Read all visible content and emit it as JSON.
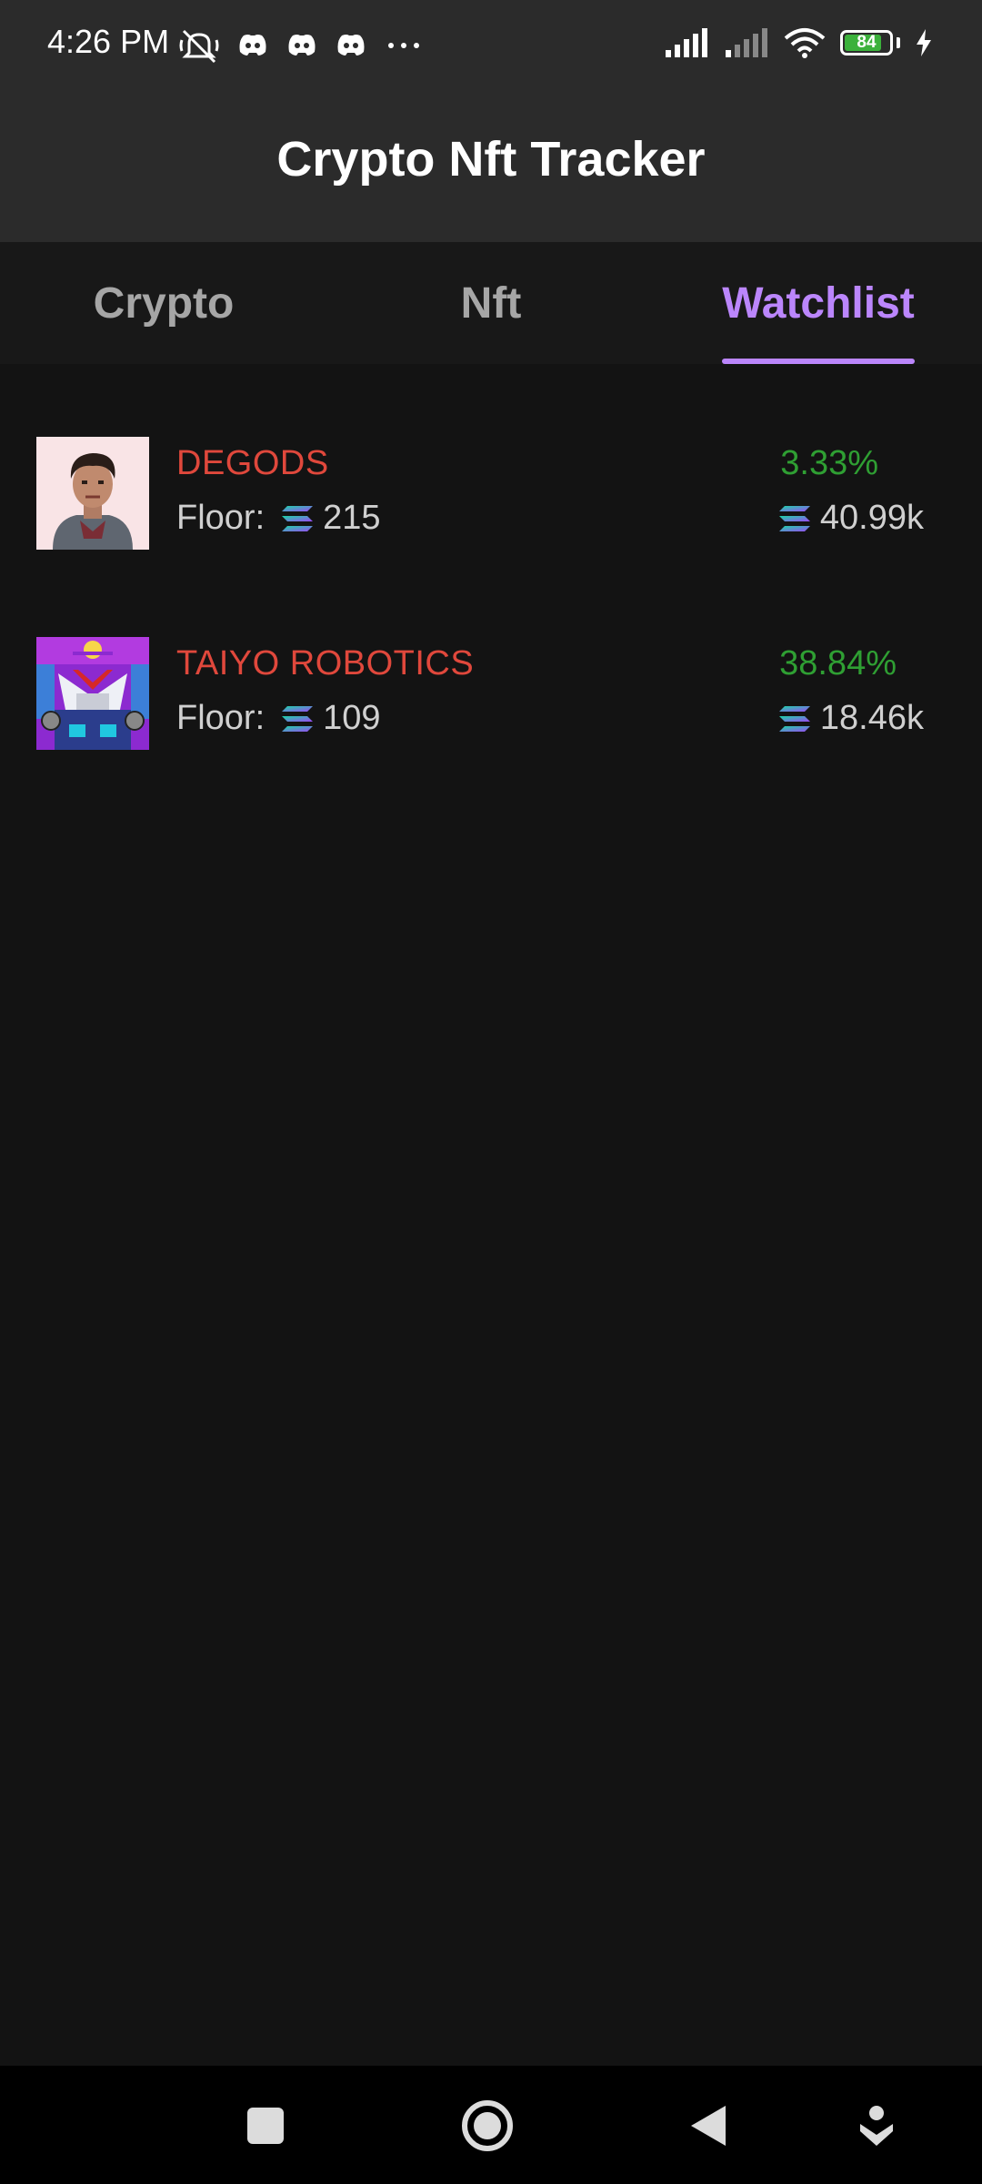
{
  "status_bar": {
    "time": "4:26 PM",
    "icons_left": [
      "mute-icon",
      "discord-icon",
      "discord-icon",
      "discord-icon",
      "more-dots-icon"
    ],
    "icons_right": [
      "signal-icon",
      "signal-icon",
      "wifi-icon",
      "battery-icon",
      "charging-icon"
    ],
    "battery_level": "84",
    "battery_fraction": 0.84
  },
  "app_bar": {
    "title": "Crypto Nft Tracker"
  },
  "tabs": [
    {
      "label": "Crypto",
      "active": false
    },
    {
      "label": "Nft",
      "active": false
    },
    {
      "label": "Watchlist",
      "active": true
    }
  ],
  "watchlist": {
    "items": [
      {
        "name": "DEGODS",
        "floor_label": "Floor:",
        "floor_value": "215",
        "change": "3.33%",
        "volume": "40.99k",
        "thumbnail": "degods-avatar"
      },
      {
        "name": "TAIYO ROBOTICS",
        "floor_label": "Floor:",
        "floor_value": "109",
        "change": "38.84%",
        "volume": "18.46k",
        "thumbnail": "taiyo-robot"
      }
    ]
  },
  "nav_bar": {
    "buttons": [
      "recent-apps-icon",
      "home-icon",
      "back-icon",
      "assistant-icon"
    ]
  },
  "colors": {
    "accent": "#bb86fc",
    "name_red": "#e0483c",
    "change_green": "#2f9f33",
    "background": "#131313",
    "bar": "#2b2b2b"
  }
}
